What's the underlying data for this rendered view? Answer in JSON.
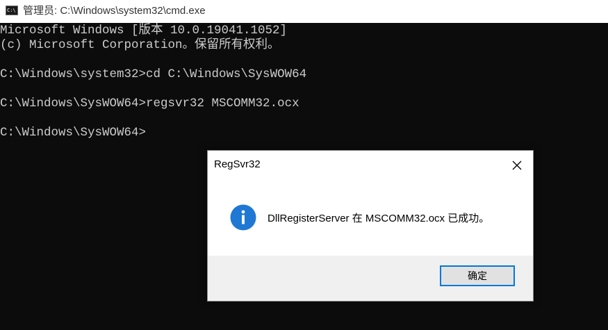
{
  "window": {
    "title": "管理员: C:\\Windows\\system32\\cmd.exe",
    "icon": "cmd-icon",
    "icon_text": "C:\\"
  },
  "console": {
    "lines": [
      "Microsoft Windows [版本 10.0.19041.1052]",
      "(c) Microsoft Corporation。保留所有权利。",
      "",
      "C:\\Windows\\system32>cd C:\\Windows\\SysWOW64",
      "",
      "C:\\Windows\\SysWOW64>regsvr32 MSCOMM32.ocx",
      "",
      "C:\\Windows\\SysWOW64>"
    ],
    "background": "#0c0c0c",
    "foreground": "#cccccc"
  },
  "dialog": {
    "title": "RegSvr32",
    "close_icon": "close-icon",
    "message_icon": "info-icon",
    "message": "DllRegisterServer 在 MSCOMM32.ocx 已成功。",
    "ok_label": "确定",
    "accent_color": "#0078d7",
    "icon_color": "#1e78d4"
  }
}
